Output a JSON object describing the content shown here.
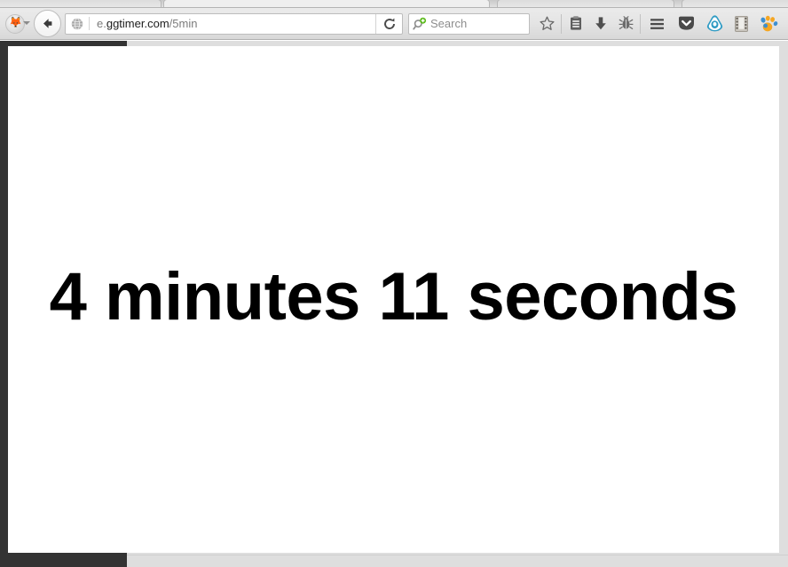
{
  "browser": {
    "tabs": [
      {
        "label": "",
        "selected": false
      },
      {
        "label": "",
        "selected": true
      },
      {
        "label": "",
        "selected": false
      }
    ],
    "back_button": {
      "name": "back-button",
      "glyph": "←"
    },
    "firefox_menu": {
      "name": "firefox-app-menu",
      "label": ""
    },
    "address_bar": {
      "prefix": "e.",
      "host": "ggtimer.com",
      "path": "/5min",
      "full_url": "e.ggtimer.com/5min",
      "identity_icon": "globe-icon",
      "reload_label": "⟳"
    },
    "search_bar": {
      "placeholder": "Search",
      "icon": "search-add-icon",
      "badge_color": "#5dbb1e"
    },
    "toolbar_buttons": [
      {
        "name": "bookmark-star-button",
        "label": "☆"
      },
      {
        "name": "reading-list-button",
        "label": ""
      },
      {
        "name": "downloads-button",
        "label": "↓"
      },
      {
        "name": "debug-bug-button",
        "label": ""
      },
      {
        "name": "menu-hamburger-button",
        "label": ""
      },
      {
        "name": "pocket-button",
        "label": ""
      },
      {
        "name": "ghostery-button",
        "label": ""
      },
      {
        "name": "video-downloadhelper-button",
        "label": ""
      },
      {
        "name": "paw-extension-button",
        "label": ""
      }
    ]
  },
  "page": {
    "title": "4 minutes 11 seconds",
    "timer_text": "4 minutes 11 seconds",
    "minutes": 4,
    "seconds": 11,
    "background_color": "#ffffff",
    "text_color": "#000000",
    "frame_color": "#333333"
  }
}
